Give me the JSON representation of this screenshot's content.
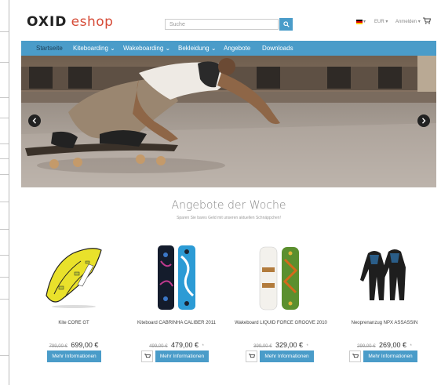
{
  "header": {
    "logo_part1": "OXID",
    "logo_part2": "eshop",
    "search_placeholder": "Suche",
    "currency": "EUR",
    "login": "Anmelden"
  },
  "nav": {
    "items": [
      {
        "label": "Startseite"
      },
      {
        "label": "Kiteboarding"
      },
      {
        "label": "Wakeboarding"
      },
      {
        "label": "Bekleidung"
      },
      {
        "label": "Angebote"
      },
      {
        "label": "Downloads"
      }
    ]
  },
  "offers": {
    "title": "Angebote der Woche",
    "subtitle": "Sparen Sie bares Geld mit unseren aktuellen Schnäppchen!"
  },
  "products": [
    {
      "name": "Kite CORE GT",
      "old_price": "799,00 €",
      "price": "699,00 €",
      "star": "",
      "button": "Mehr Informationen",
      "has_cart": false
    },
    {
      "name": "Kiteboard CABRINHA CALIBER 2011",
      "old_price": "499,00 €",
      "price": "479,00 €",
      "star": "*",
      "button": "Mehr Informationen",
      "has_cart": true
    },
    {
      "name": "Wakeboard LIQUID FORCE GROOVE 2010",
      "old_price": "399,00 €",
      "price": "329,00 €",
      "star": "*",
      "button": "Mehr Informationen",
      "has_cart": true
    },
    {
      "name": "Neoprenanzug NPX ASSASSIN",
      "old_price": "299,00 €",
      "price": "269,00 €",
      "star": "*",
      "button": "Mehr Informationen",
      "has_cart": true
    }
  ],
  "colors": {
    "accent": "#4a9cc9",
    "logo_red": "#d64b37"
  }
}
